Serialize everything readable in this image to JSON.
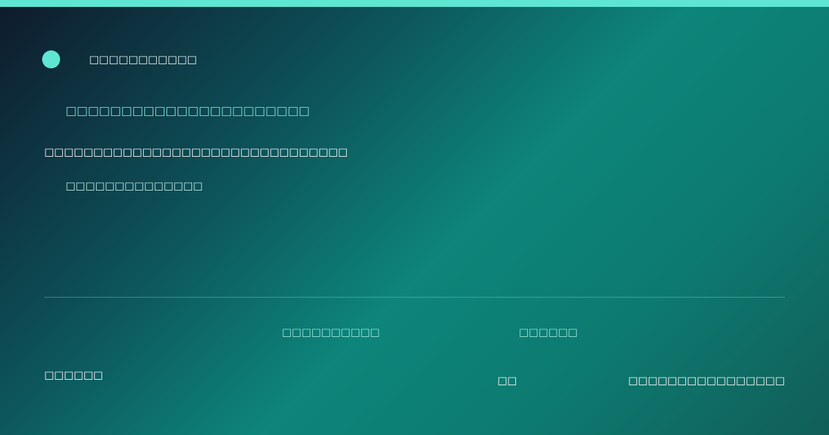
{
  "colors": {
    "accent": "#5ee6d2"
  },
  "header": {
    "brand_text": "□□□□□□□□□□□"
  },
  "hero": {
    "headline": "□□□□□□□□□□□□□□□□□□□□□□",
    "subline": "□□□□□□□□□□□□□□□□□□□□□□□□□□□□□□□",
    "tagline": "□□□□□□□□□□□□□□"
  },
  "meta": {
    "item_a": "□□□□□□□□□□",
    "item_b": "□□□□□□"
  },
  "footer": {
    "left": "□□□□□□",
    "middle": "□□",
    "right": "□□□□□□□□□□□□□□□□"
  }
}
